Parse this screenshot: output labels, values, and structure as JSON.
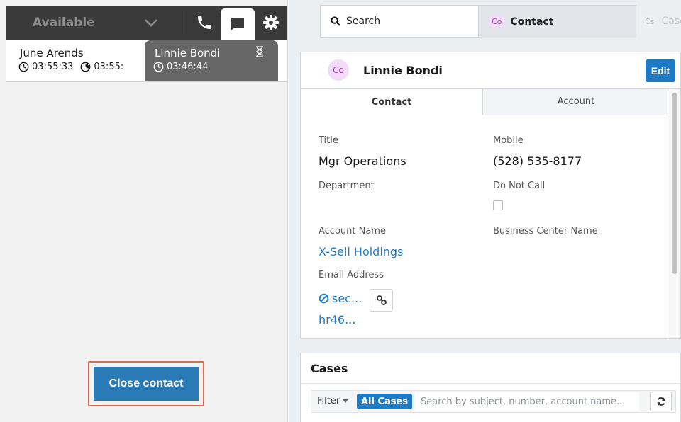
{
  "ccp": {
    "status": "Available",
    "contacts": [
      {
        "name": "June Arends",
        "time1": "03:55:33",
        "time2": "03:55:"
      },
      {
        "name": "Linnie Bondi",
        "time": "03:46:44"
      }
    ],
    "close_label": "Close contact"
  },
  "crm": {
    "tabs": {
      "search": "Search",
      "contact_badge": "Co",
      "contact": "Contact",
      "cases_badge": "Cs",
      "cases": "Case"
    },
    "record": {
      "avatar": "Co",
      "name": "Linnie Bondi",
      "edit_label": "Edit",
      "tab_contact": "Contact",
      "tab_account": "Account",
      "fields": {
        "title_label": "Title",
        "title_value": "Mgr Operations",
        "mobile_label": "Mobile",
        "mobile_value": "(528) 535-8177",
        "department_label": "Department",
        "dnc_label": "Do Not Call",
        "account_label": "Account Name",
        "account_value": "X-Sell Holdings",
        "bcn_label": "Business Center Name",
        "email_label": "Email Address",
        "email_line1": "sec...",
        "email_line2": "hr46..."
      }
    },
    "cases": {
      "title": "Cases",
      "filter": "Filter",
      "all_cases": "All Cases",
      "search_placeholder": "Search by subject, number, account name..."
    }
  },
  "colors": {
    "ccp_dark": "#3a3a3a",
    "active_tab": "#666666",
    "primary_blue": "#1f7ac4",
    "close_button": "#2a7ab6",
    "highlight_border": "#e06c4f",
    "contact_badge_bg": "#f2dcf7"
  }
}
